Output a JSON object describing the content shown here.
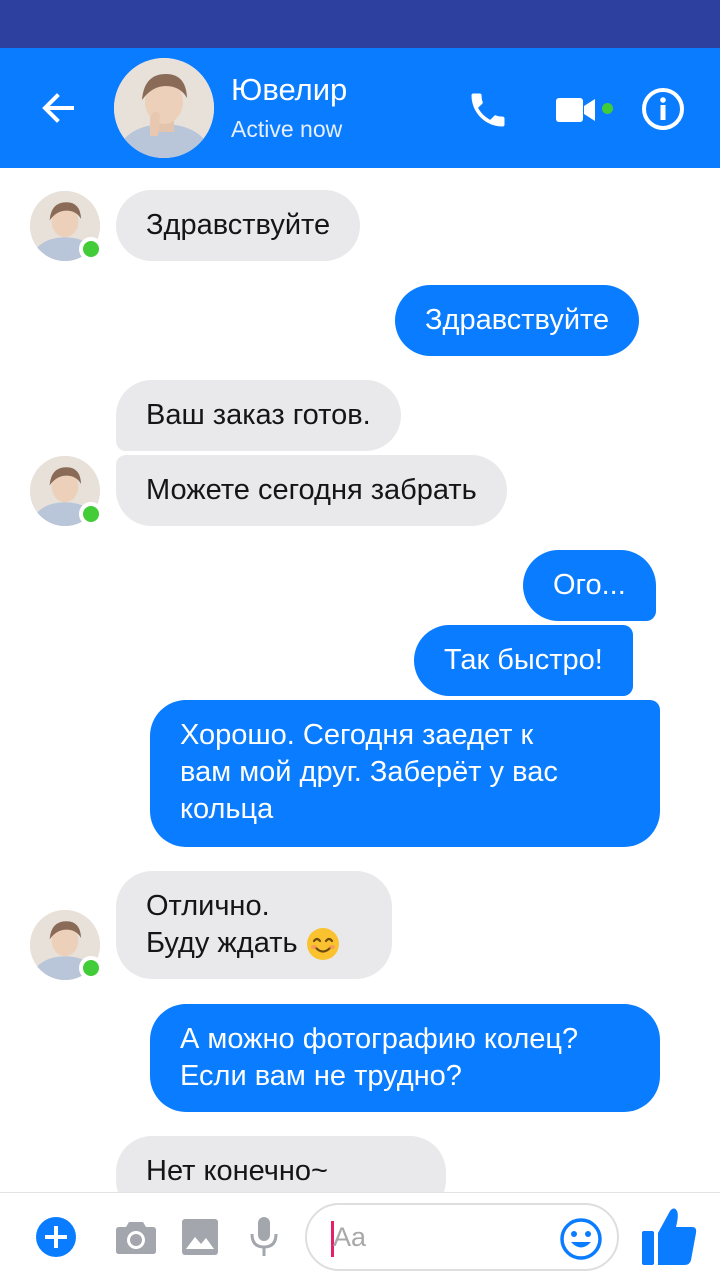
{
  "header": {
    "title": "Ювелир",
    "status": "Active now",
    "accent_color": "#0a7cff",
    "online_color": "#42cc38",
    "icons": [
      "back-arrow-icon",
      "phone-icon",
      "video-camera-icon",
      "info-icon"
    ]
  },
  "messages": [
    {
      "side": "incoming",
      "text": "Здравствуйте"
    },
    {
      "side": "outgoing",
      "text": "Здравствуйте"
    },
    {
      "side": "incoming",
      "text": "Ваш заказ готов."
    },
    {
      "side": "incoming",
      "text": "Можете сегодня забрать"
    },
    {
      "side": "outgoing",
      "text": "Ого..."
    },
    {
      "side": "outgoing",
      "text": "Так быстро!"
    },
    {
      "side": "outgoing",
      "lines": [
        "Хорошо. Сегодня заедет к",
        "вам мой друг. Заберёт у вас",
        "кольца"
      ]
    },
    {
      "side": "incoming",
      "lines": [
        "Отлично.",
        "Буду ждать"
      ],
      "emoji": "smiling-face-emoji"
    },
    {
      "side": "outgoing",
      "lines": [
        "А можно фотографию колец?",
        "Если вам не трудно?"
      ]
    },
    {
      "side": "incoming",
      "text": "Нет конечно~"
    }
  ],
  "composer": {
    "placeholder": "Aa",
    "icons": [
      "plus-icon",
      "camera-icon",
      "image-icon",
      "microphone-icon",
      "emoji-icon",
      "thumbs-up-icon"
    ]
  }
}
